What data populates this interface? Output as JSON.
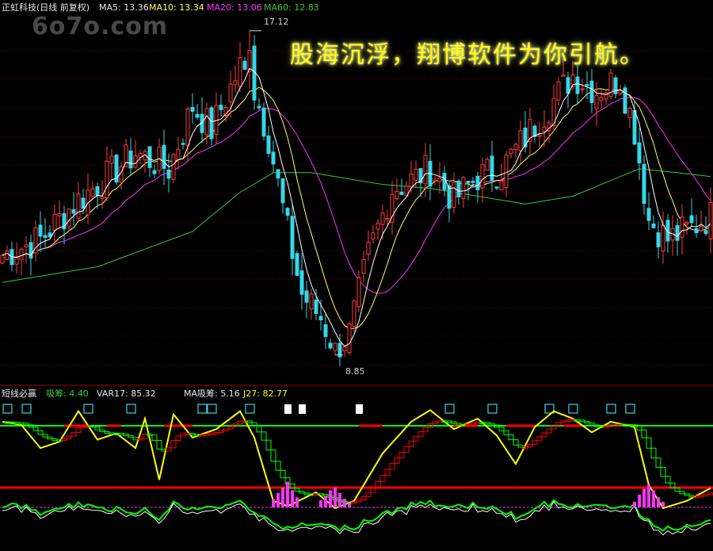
{
  "watermark": "6o7o.com",
  "slogan": "股海沉浮，翔博软件为你引航。",
  "main_header": {
    "title": "正虹科技(日线 前复权)",
    "ma5": "MA5: 13.36",
    "ma10": "MA10: 13.34",
    "ma20": "MA20: 13.06",
    "ma60": "MA60: 12.83"
  },
  "sub_header": {
    "title": "短线必赢",
    "xichou": "吸筹: 4.40",
    "var17": "VAR17: 85.32",
    "maxichou": "MA吸筹: 5.16",
    "j27": "J27: 82.77"
  },
  "colors": {
    "background": "#000000",
    "up": "#ff3b3b",
    "down": "#36d6e6",
    "ma5": "#ffffff",
    "ma10": "#ffff66",
    "ma20": "#ff33ff",
    "ma60": "#33cc33",
    "grid": "#7a0000",
    "sub_yellow": "#ffff00",
    "sub_green": "#00ff00",
    "sub_red": "#ff0000",
    "sub_magenta": "#ff33ff",
    "signal_box": "#36d6e6"
  },
  "chart_data": {
    "type": "candlestick",
    "title": "正虹科技(日线 前复权)",
    "high_label": "17.12",
    "low_label": "8.85",
    "high_value": 17.12,
    "low_value": 8.85,
    "ylim": [
      8.4,
      17.5
    ],
    "x_count": 150,
    "high_index": 52,
    "low_index": 70,
    "price_points": [
      [
        0,
        11.4
      ],
      [
        8,
        11.8
      ],
      [
        15,
        12.7
      ],
      [
        22,
        13.4
      ],
      [
        28,
        14.0
      ],
      [
        35,
        13.6
      ],
      [
        40,
        15.2
      ],
      [
        44,
        14.6
      ],
      [
        50,
        16.2
      ],
      [
        53,
        15.6
      ],
      [
        56,
        14.4
      ],
      [
        60,
        12.0
      ],
      [
        63,
        10.4
      ],
      [
        67,
        9.8
      ],
      [
        70,
        9.0
      ],
      [
        73,
        9.4
      ],
      [
        77,
        11.4
      ],
      [
        82,
        13.1
      ],
      [
        86,
        13.3
      ],
      [
        90,
        13.6
      ],
      [
        95,
        12.8
      ],
      [
        100,
        13.4
      ],
      [
        105,
        13.6
      ],
      [
        110,
        14.4
      ],
      [
        115,
        15.2
      ],
      [
        120,
        16.0
      ],
      [
        125,
        15.6
      ],
      [
        130,
        15.9
      ],
      [
        133,
        14.6
      ],
      [
        136,
        12.3
      ],
      [
        140,
        11.8
      ],
      [
        145,
        12.1
      ],
      [
        149,
        12.4
      ]
    ],
    "ma60_points": [
      [
        0,
        10.7
      ],
      [
        20,
        11.1
      ],
      [
        40,
        12.0
      ],
      [
        50,
        13.0
      ],
      [
        57,
        13.5
      ],
      [
        65,
        13.5
      ],
      [
        80,
        13.2
      ],
      [
        90,
        13.1
      ],
      [
        100,
        12.9
      ],
      [
        110,
        12.7
      ],
      [
        120,
        12.9
      ],
      [
        128,
        13.3
      ],
      [
        134,
        13.6
      ],
      [
        142,
        13.5
      ],
      [
        149,
        13.4
      ]
    ],
    "sub_indicators": [
      "吸筹",
      "VAR17",
      "MA吸筹",
      "J27"
    ],
    "j27_points": [
      [
        0,
        85
      ],
      [
        4,
        82
      ],
      [
        8,
        60
      ],
      [
        12,
        66
      ],
      [
        16,
        95
      ],
      [
        20,
        68
      ],
      [
        24,
        74
      ],
      [
        28,
        60
      ],
      [
        30,
        88
      ],
      [
        33,
        30
      ],
      [
        36,
        92
      ],
      [
        40,
        70
      ],
      [
        45,
        78
      ],
      [
        50,
        95
      ],
      [
        53,
        70
      ],
      [
        57,
        10
      ],
      [
        60,
        5
      ],
      [
        66,
        18
      ],
      [
        70,
        3
      ],
      [
        74,
        10
      ],
      [
        80,
        55
      ],
      [
        86,
        85
      ],
      [
        90,
        96
      ],
      [
        95,
        78
      ],
      [
        100,
        88
      ],
      [
        104,
        72
      ],
      [
        108,
        45
      ],
      [
        112,
        80
      ],
      [
        116,
        95
      ],
      [
        120,
        88
      ],
      [
        124,
        75
      ],
      [
        128,
        85
      ],
      [
        133,
        80
      ],
      [
        136,
        25
      ],
      [
        139,
        3
      ],
      [
        144,
        10
      ],
      [
        149,
        22
      ]
    ],
    "xichou_bars": [
      [
        57,
        6
      ],
      [
        58,
        10
      ],
      [
        59,
        14
      ],
      [
        60,
        18
      ],
      [
        61,
        12
      ],
      [
        62,
        7
      ],
      [
        67,
        5
      ],
      [
        68,
        8
      ],
      [
        69,
        12
      ],
      [
        70,
        14
      ],
      [
        71,
        10
      ],
      [
        72,
        6
      ],
      [
        73,
        3
      ],
      [
        133,
        4
      ],
      [
        134,
        9
      ],
      [
        135,
        13
      ],
      [
        136,
        16
      ],
      [
        137,
        12
      ],
      [
        138,
        7
      ],
      [
        139,
        4
      ]
    ],
    "signal_box_indices": [
      1,
      5,
      18,
      27,
      42,
      44,
      52,
      94,
      103,
      115,
      120,
      128,
      132
    ],
    "signal_white_indices": [
      60,
      63,
      75
    ],
    "red_band_ranges": [
      [
        13,
        18
      ],
      [
        22,
        25
      ],
      [
        34,
        40
      ],
      [
        75,
        80
      ],
      [
        95,
        100
      ],
      [
        106,
        112
      ],
      [
        118,
        122
      ]
    ]
  }
}
